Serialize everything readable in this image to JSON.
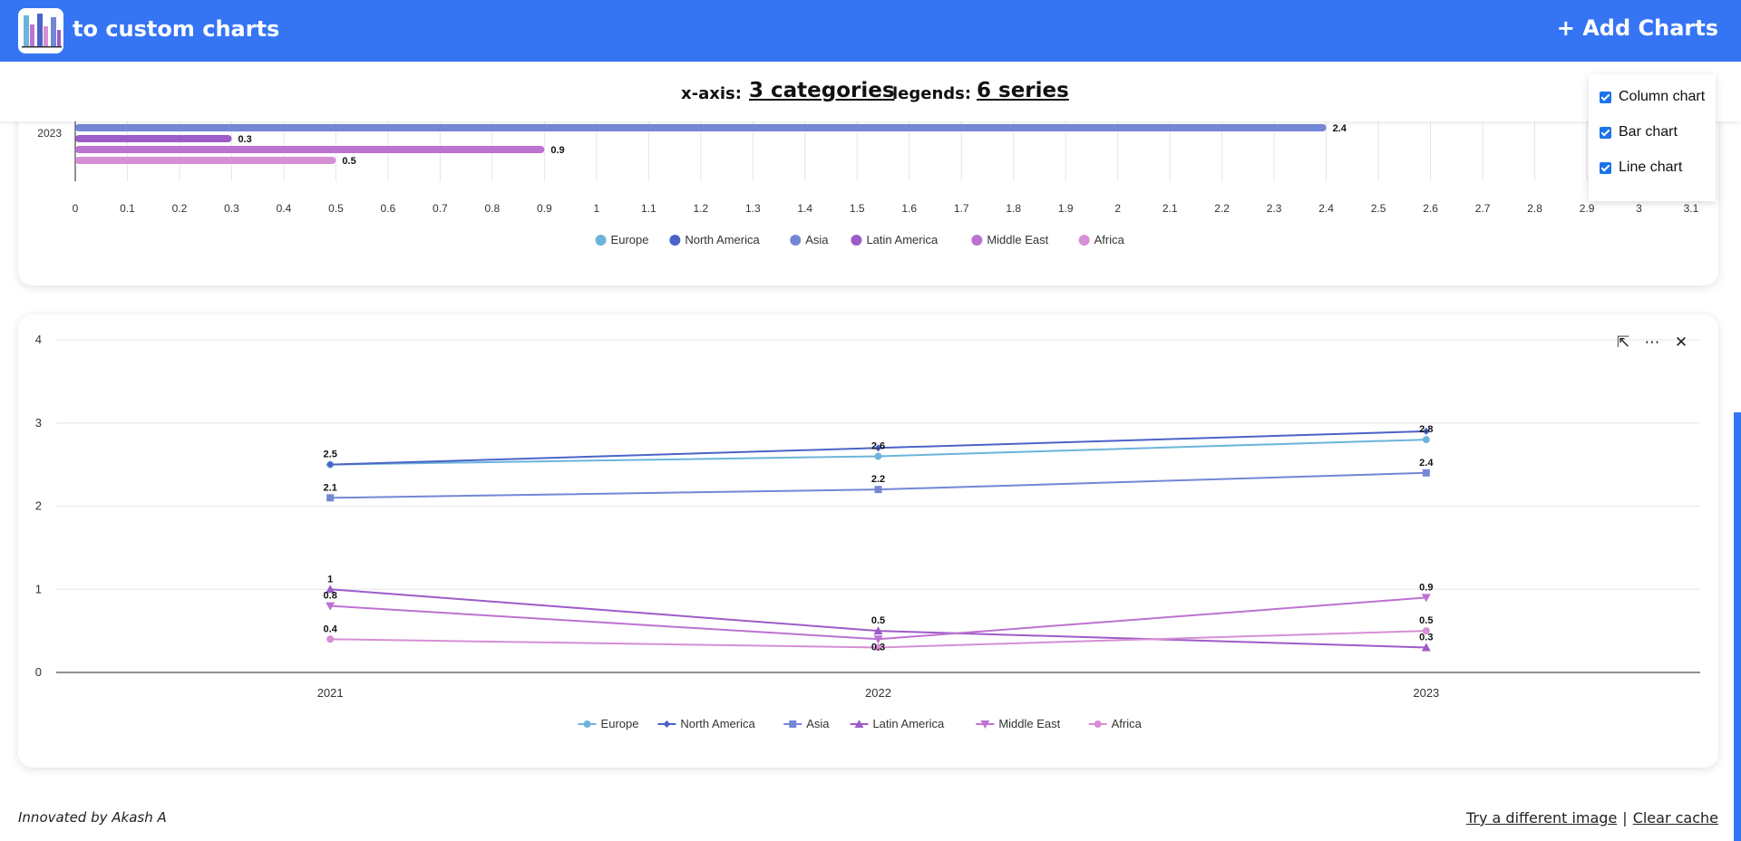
{
  "header": {
    "title": "to custom charts",
    "add_charts_label": "+ Add Charts",
    "logo_icon": "bar-chart-logo-icon"
  },
  "axis_summary": {
    "x_label": "x-axis:",
    "x_value": "3 categories",
    "legend_label": "legends:",
    "legend_value": "6 series"
  },
  "chart_toggles": [
    {
      "label": "Column chart",
      "checked": true
    },
    {
      "label": "Bar chart",
      "checked": true
    },
    {
      "label": "Line chart",
      "checked": true
    }
  ],
  "colors": {
    "accent": "#3575f4"
  },
  "chart_data": [
    {
      "type": "bar",
      "orientation": "horizontal",
      "visible_categories": [
        "2023"
      ],
      "series": [
        {
          "name": "Europe",
          "color": "#6cb4da",
          "values": [
            null
          ]
        },
        {
          "name": "North America",
          "color": "#4b63c9",
          "values": [
            null
          ]
        },
        {
          "name": "Asia",
          "color": "#7387d6",
          "values": [
            2.4
          ]
        },
        {
          "name": "Latin America",
          "color": "#9d5cc8",
          "values": [
            0.3
          ]
        },
        {
          "name": "Middle East",
          "color": "#bd72d2",
          "values": [
            0.9
          ]
        },
        {
          "name": "Africa",
          "color": "#d68fd4",
          "values": [
            0.5
          ]
        }
      ],
      "xlim": [
        0,
        3.1
      ],
      "x_ticks": [
        "0",
        "0.1",
        "0.2",
        "0.3",
        "0.4",
        "0.5",
        "0.6",
        "0.7",
        "0.8",
        "0.9",
        "1",
        "1.1",
        "1.2",
        "1.3",
        "1.4",
        "1.5",
        "1.6",
        "1.7",
        "1.8",
        "1.9",
        "2",
        "2.1",
        "2.2",
        "2.3",
        "2.4",
        "2.5",
        "2.6",
        "2.7",
        "2.8",
        "2.9",
        "3",
        "3.1"
      ],
      "grid": true,
      "legend": "bottom-center"
    },
    {
      "type": "line",
      "categories": [
        "2021",
        "2022",
        "2023"
      ],
      "series": [
        {
          "name": "Europe",
          "color": "#6cb4da",
          "marker": "circle",
          "values": [
            2.5,
            2.6,
            2.8
          ]
        },
        {
          "name": "North America",
          "color": "#4b63c9",
          "marker": "diamond",
          "values": [
            2.5,
            2.7,
            2.9
          ]
        },
        {
          "name": "Asia",
          "color": "#7387d6",
          "marker": "square",
          "values": [
            2.1,
            2.2,
            2.4
          ]
        },
        {
          "name": "Latin America",
          "color": "#9d5cc8",
          "marker": "triangle",
          "values": [
            1,
            0.5,
            0.3
          ]
        },
        {
          "name": "Middle East",
          "color": "#bd72d2",
          "marker": "triangle-down",
          "values": [
            0.8,
            0.4,
            0.9
          ]
        },
        {
          "name": "Africa",
          "color": "#d68fd4",
          "marker": "circle",
          "values": [
            0.4,
            0.3,
            0.5
          ]
        }
      ],
      "data_labels": [
        {
          "series": "North America",
          "category": "2021",
          "text": "2.5"
        },
        {
          "series": "North America",
          "category": "2022",
          "text": "2.6"
        },
        {
          "series": "North America",
          "category": "2023",
          "text": "2.8"
        },
        {
          "series": "Asia",
          "category": "2021",
          "text": "2.1"
        },
        {
          "series": "Asia",
          "category": "2022",
          "text": "2.2"
        },
        {
          "series": "Asia",
          "category": "2023",
          "text": "2.4"
        },
        {
          "series": "Latin America",
          "category": "2021",
          "text": "1"
        },
        {
          "series": "Middle East",
          "category": "2021",
          "text": "0.8"
        },
        {
          "series": "Africa",
          "category": "2021",
          "text": "0.4"
        },
        {
          "series": "Middle East",
          "category": "2022",
          "text": "0.5"
        },
        {
          "series": "Middle East",
          "category": "2022",
          "text": "0.3",
          "offset": "below"
        },
        {
          "series": "Middle East",
          "category": "2023",
          "text": "0.9"
        },
        {
          "series": "Africa",
          "category": "2023",
          "text": "0.5"
        },
        {
          "series": "Latin America",
          "category": "2023",
          "text": "0.3"
        }
      ],
      "ylim": [
        0,
        4
      ],
      "y_ticks": [
        "0",
        "1",
        "2",
        "3",
        "4"
      ],
      "grid": true,
      "legend": "bottom-center"
    }
  ],
  "chart_tools": {
    "expand_icon": "expand-icon",
    "more_icon": "more-icon",
    "close_icon": "close-icon"
  },
  "footer": {
    "credit": "Innovated by Akash A",
    "try_label": "Try a different image",
    "separator": "|",
    "clear_label": "Clear cache"
  }
}
